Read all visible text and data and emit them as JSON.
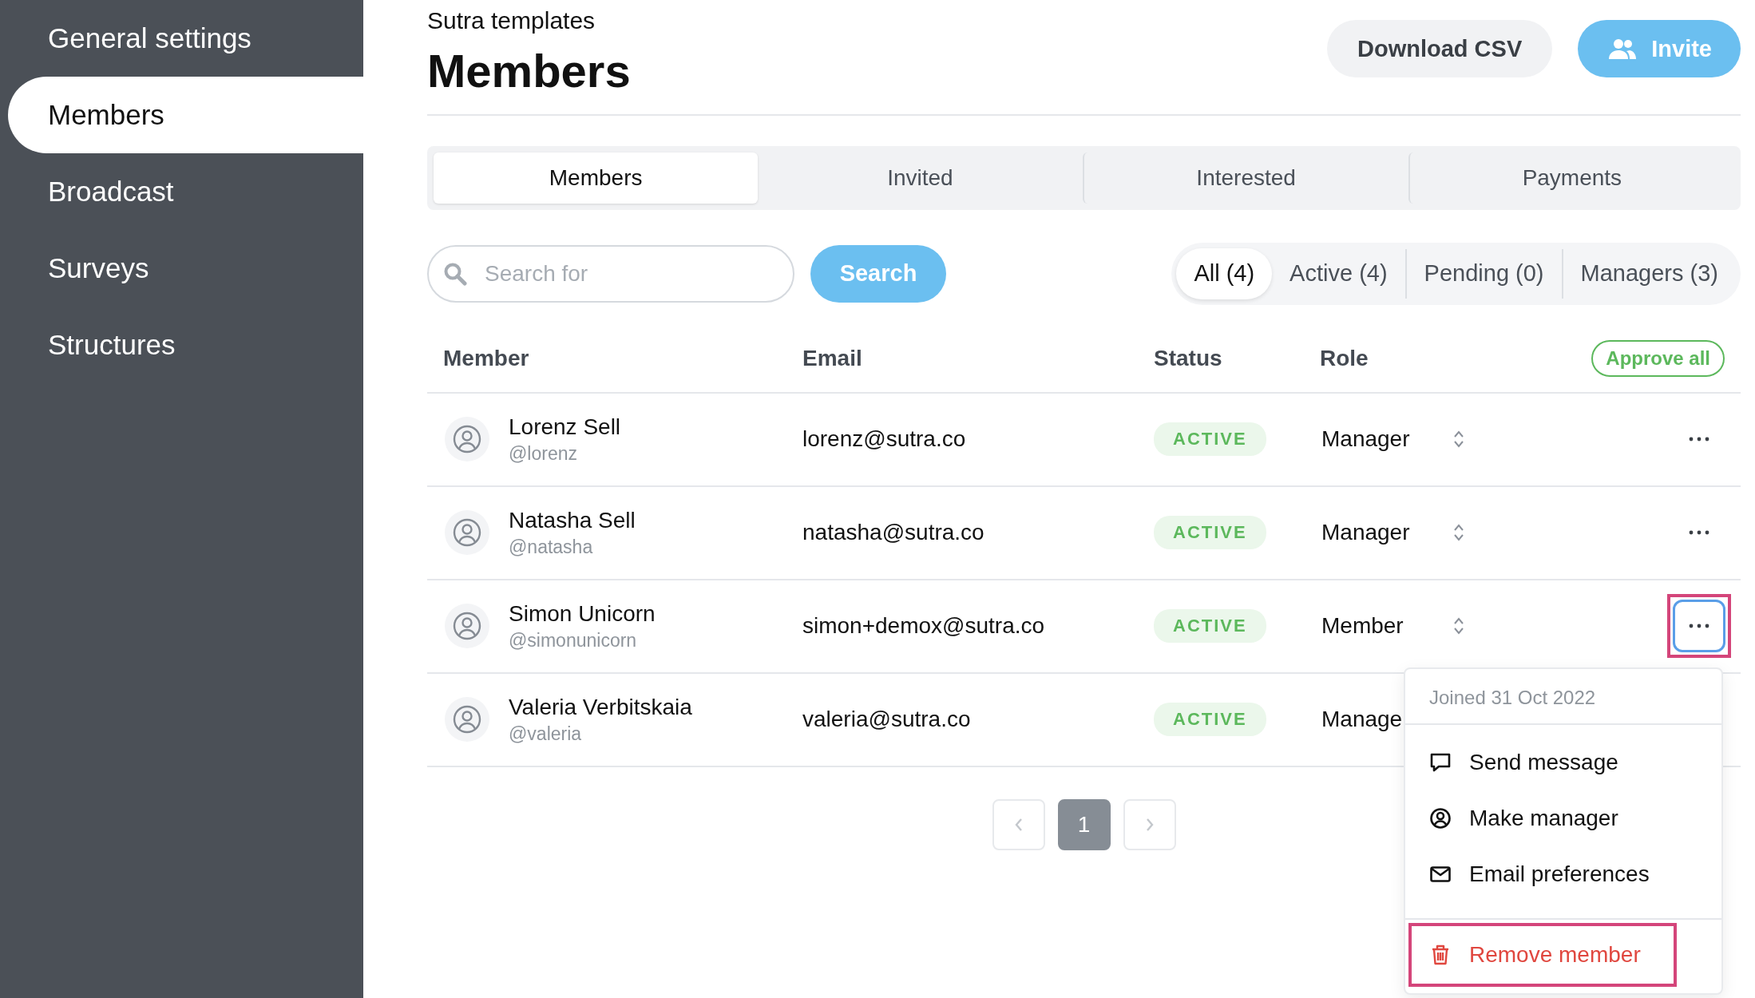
{
  "sidebar": {
    "items": [
      {
        "label": "General settings",
        "selected": false
      },
      {
        "label": "Members",
        "selected": true
      },
      {
        "label": "Broadcast",
        "selected": false
      },
      {
        "label": "Surveys",
        "selected": false
      },
      {
        "label": "Structures",
        "selected": false
      }
    ]
  },
  "header": {
    "subtitle": "Sutra templates",
    "title": "Members",
    "buttons": [
      {
        "label": "Download CSV",
        "kind": "secondary"
      },
      {
        "label": "Invite",
        "kind": "primary"
      }
    ]
  },
  "tabs": [
    {
      "label": "Members",
      "selected": true
    },
    {
      "label": "Invited",
      "selected": false
    },
    {
      "label": "Interested",
      "selected": false
    },
    {
      "label": "Payments",
      "selected": false
    }
  ],
  "search": {
    "placeholder": "Search for",
    "button": "Search"
  },
  "filters": [
    {
      "label": "All (4)",
      "selected": true
    },
    {
      "label": "Active (4)",
      "selected": false
    },
    {
      "label": "Pending (0)",
      "selected": false
    },
    {
      "label": "Managers (3)",
      "selected": false
    }
  ],
  "table": {
    "columns": [
      "Member",
      "Email",
      "Status",
      "Role"
    ],
    "approve_all": "Approve all",
    "rows": [
      {
        "name": "Lorenz Sell",
        "handle": "@lorenz",
        "email": "lorenz@sutra.co",
        "status": "ACTIVE",
        "role": "Manager",
        "role_selector": true,
        "actions_button": true,
        "menu_open": false
      },
      {
        "name": "Natasha Sell",
        "handle": "@natasha",
        "email": "natasha@sutra.co",
        "status": "ACTIVE",
        "role": "Manager",
        "role_selector": true,
        "actions_button": true,
        "menu_open": false
      },
      {
        "name": "Simon Unicorn",
        "handle": "@simonunicorn",
        "email": "simon+demox@sutra.co",
        "status": "ACTIVE",
        "role": "Member",
        "role_selector": true,
        "actions_button": true,
        "menu_open": true
      },
      {
        "name": "Valeria Verbitskaia",
        "handle": "@valeria",
        "email": "valeria@sutra.co",
        "status": "ACTIVE",
        "role": "Manage"
      }
    ]
  },
  "menu": {
    "header": "Joined 31 Oct 2022",
    "items": [
      {
        "label": "Send message",
        "kind": "message",
        "highlighted": false
      },
      {
        "label": "Make manager",
        "kind": "user",
        "highlighted": false
      },
      {
        "label": "Email preferences",
        "kind": "mail",
        "highlighted": false
      },
      {
        "label": "Remove member",
        "kind": "delete",
        "highlighted": true
      }
    ]
  },
  "pagination": {
    "pages": [
      {
        "label": "1",
        "selected": true
      }
    ]
  }
}
